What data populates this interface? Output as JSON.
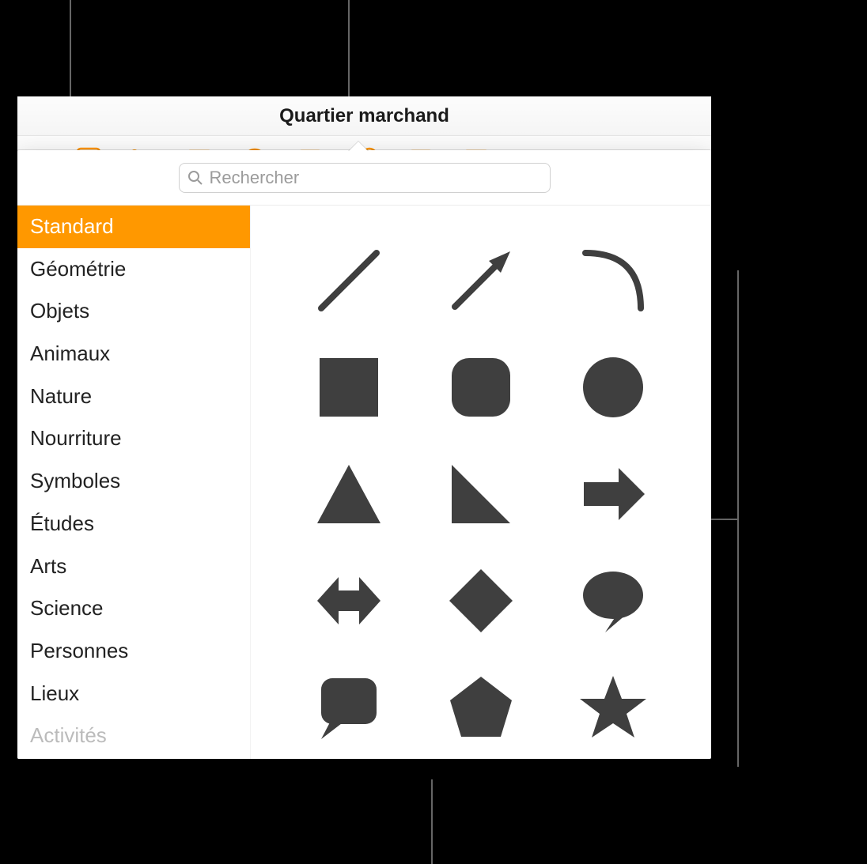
{
  "title": "Quartier marchand",
  "accent_color": "#ff9500",
  "shape_fill": "#3f3f3f",
  "toolbar": {
    "icons": [
      "add-icon",
      "list-add-icon",
      "table-icon",
      "chart-icon",
      "text-box-icon",
      "shape-icon",
      "image-icon",
      "comment-icon"
    ]
  },
  "search": {
    "placeholder": "Rechercher"
  },
  "categories": [
    {
      "label": "Standard",
      "selected": true
    },
    {
      "label": "Géométrie",
      "selected": false
    },
    {
      "label": "Objets",
      "selected": false
    },
    {
      "label": "Animaux",
      "selected": false
    },
    {
      "label": "Nature",
      "selected": false
    },
    {
      "label": "Nourriture",
      "selected": false
    },
    {
      "label": "Symboles",
      "selected": false
    },
    {
      "label": "Études",
      "selected": false
    },
    {
      "label": "Arts",
      "selected": false
    },
    {
      "label": "Science",
      "selected": false
    },
    {
      "label": "Personnes",
      "selected": false
    },
    {
      "label": "Lieux",
      "selected": false
    },
    {
      "label": "Activités",
      "selected": false
    }
  ],
  "shapes": [
    "line",
    "arrow-line",
    "arc",
    "square",
    "rounded-square",
    "circle",
    "triangle",
    "right-triangle",
    "arrow-right",
    "double-arrow",
    "diamond",
    "speech-bubble-round",
    "speech-bubble-square",
    "pentagon",
    "star"
  ]
}
